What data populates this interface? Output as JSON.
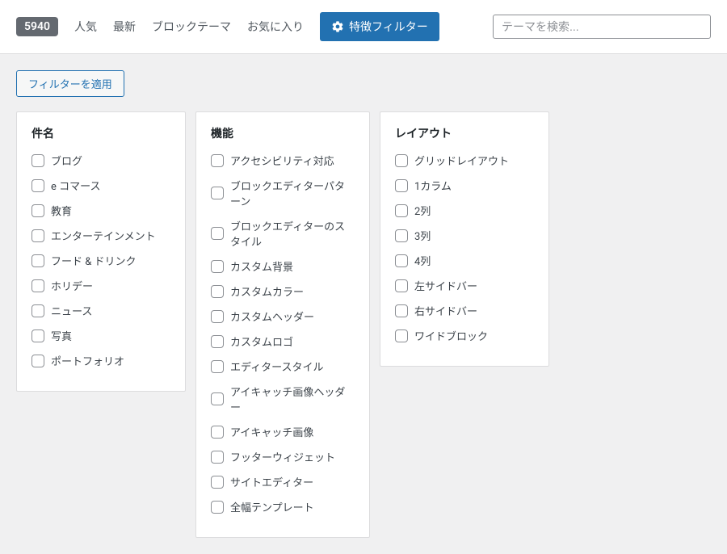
{
  "topbar": {
    "count": "5940",
    "tabs": {
      "popular": "人気",
      "latest": "最新",
      "block_themes": "ブロックテーマ",
      "favorites": "お気に入り"
    },
    "feature_filter_label": "特徴フィルター",
    "search_placeholder": "テーマを検索..."
  },
  "apply_button_label": "フィルターを適用",
  "columns": {
    "subject": {
      "title": "件名",
      "items": [
        "ブログ",
        "e コマース",
        "教育",
        "エンターテインメント",
        "フード & ドリンク",
        "ホリデー",
        "ニュース",
        "写真",
        "ポートフォリオ"
      ]
    },
    "features": {
      "title": "機能",
      "items": [
        "アクセシビリティ対応",
        "ブロックエディターパターン",
        "ブロックエディターのスタイル",
        "カスタム背景",
        "カスタムカラー",
        "カスタムヘッダー",
        "カスタムロゴ",
        "エディタースタイル",
        "アイキャッチ画像ヘッダー",
        "アイキャッチ画像",
        "フッターウィジェット",
        "サイトエディター",
        "全幅テンプレート"
      ]
    },
    "layout": {
      "title": "レイアウト",
      "items": [
        "グリッドレイアウト",
        "1カラム",
        "2列",
        "3列",
        "4列",
        "左サイドバー",
        "右サイドバー",
        "ワイドブロック"
      ]
    }
  }
}
